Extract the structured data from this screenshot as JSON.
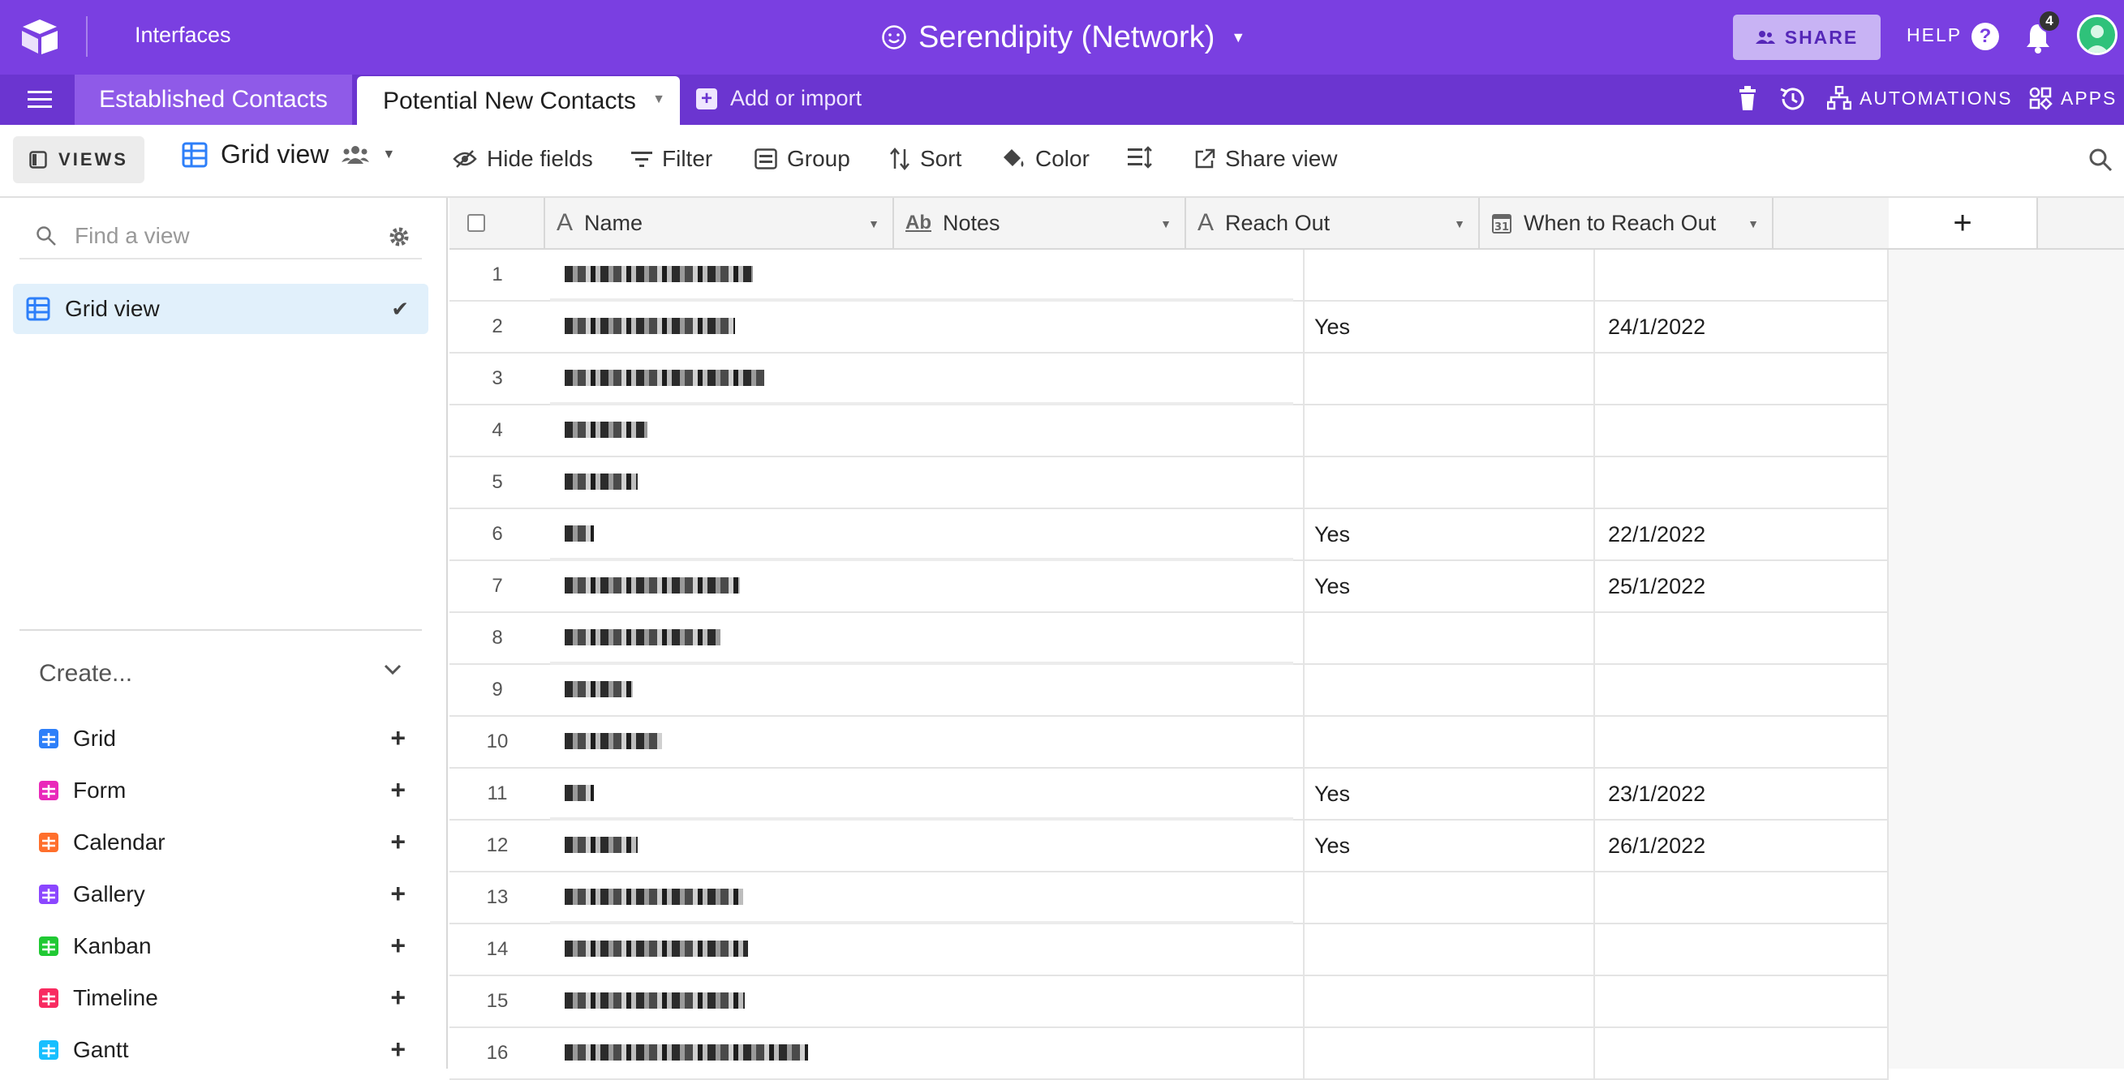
{
  "topbar": {
    "interfaces": "Interfaces",
    "base_title": "Serendipity (Network)",
    "share_label": "SHARE",
    "help_label": "HELP",
    "notification_count": "4"
  },
  "tabs": {
    "established": "Established Contacts",
    "potential": "Potential New Contacts",
    "add_import": "Add or import"
  },
  "tab_actions": {
    "automations": "AUTOMATIONS",
    "apps": "APPS"
  },
  "viewbar": {
    "views_label": "VIEWS",
    "current_view": "Grid view",
    "tools": [
      "Hide fields",
      "Filter",
      "Group",
      "Sort",
      "Color",
      "",
      "Share view"
    ]
  },
  "sidebar": {
    "find_placeholder": "Find a view",
    "active_view": "Grid view",
    "create_label": "Create...",
    "create_items": [
      {
        "label": "Grid",
        "color": "#2d7ff9"
      },
      {
        "label": "Form",
        "color": "#e929ba"
      },
      {
        "label": "Calendar",
        "color": "#ff6f2c"
      },
      {
        "label": "Gallery",
        "color": "#8b46ff"
      },
      {
        "label": "Kanban",
        "color": "#20c933"
      },
      {
        "label": "Timeline",
        "color": "#f82b60"
      },
      {
        "label": "Gantt",
        "color": "#18bfff"
      }
    ]
  },
  "grid": {
    "columns": [
      "Name",
      "Notes",
      "Reach Out",
      "When to Reach Out"
    ],
    "rows": [
      {
        "num": "1",
        "reach": "",
        "when": ""
      },
      {
        "num": "2",
        "reach": "Yes",
        "when": "24/1/2022"
      },
      {
        "num": "3",
        "reach": "",
        "when": ""
      },
      {
        "num": "4",
        "reach": "",
        "when": ""
      },
      {
        "num": "5",
        "reach": "",
        "when": ""
      },
      {
        "num": "6",
        "reach": "Yes",
        "when": "22/1/2022"
      },
      {
        "num": "7",
        "reach": "Yes",
        "when": "25/1/2022"
      },
      {
        "num": "8",
        "reach": "",
        "when": ""
      },
      {
        "num": "9",
        "reach": "",
        "when": ""
      },
      {
        "num": "10",
        "reach": "",
        "when": ""
      },
      {
        "num": "11",
        "reach": "Yes",
        "when": "23/1/2022"
      },
      {
        "num": "12",
        "reach": "Yes",
        "when": "26/1/2022"
      },
      {
        "num": "13",
        "reach": "",
        "when": ""
      },
      {
        "num": "14",
        "reach": "",
        "when": ""
      },
      {
        "num": "15",
        "reach": "",
        "when": ""
      },
      {
        "num": "16",
        "reach": "",
        "when": ""
      }
    ]
  }
}
